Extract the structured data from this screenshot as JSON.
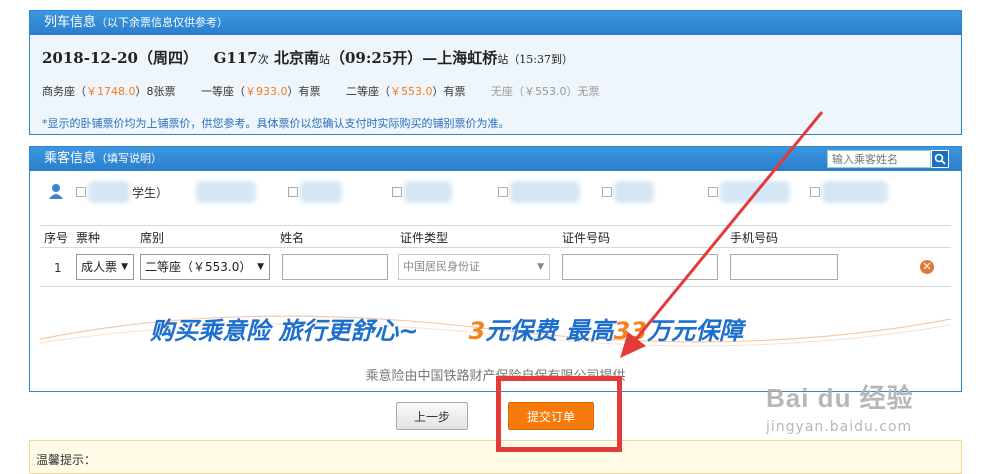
{
  "train_panel": {
    "title": "列车信息",
    "subtitle": "（以下余票信息仅供参考）",
    "date": "2018-12-20（周四）",
    "train_no": "G117",
    "train_suffix": "次",
    "from": "北京南",
    "from_suffix": "站",
    "depart": "（09:25开）",
    "dash": "—",
    "to": "上海虹桥",
    "to_suffix": "站",
    "arrive": "（15:37到）",
    "seats": [
      {
        "name": "商务座（",
        "price": "￥1748.0",
        "close": "）",
        "avail": "8张票"
      },
      {
        "name": "一等座（",
        "price": "￥933.0",
        "close": "）",
        "avail": "有票"
      },
      {
        "name": "二等座（",
        "price": "￥553.0",
        "close": "）",
        "avail": "有票"
      }
    ],
    "no_seat": "无座（￥553.0）无票",
    "note": "*显示的卧铺票价均为上铺票价，供您参考。具体票价以您确认支付时实际购买的铺别票价为准。"
  },
  "passenger_panel": {
    "title": "乘客信息",
    "subtitle": "（填写说明）",
    "search_placeholder": "输入乘客姓名",
    "first_contact_tail": "学生）",
    "columns": {
      "index": "序号",
      "ticket_type": "票种",
      "seat_class": "席别",
      "name": "姓名",
      "id_type": "证件类型",
      "id_no": "证件号码",
      "phone": "手机号码"
    },
    "row": {
      "index": "1",
      "ticket_type": "成人票",
      "seat_class": "二等座（￥553.0）",
      "id_type": "中国居民身份证"
    }
  },
  "banner": {
    "part1": "购买乘意险  旅行更舒心~",
    "num1": "3",
    "part2": "元保费  最高",
    "num2": "33",
    "part3": "万元保障",
    "sub": "乘意险由中国铁路财产保险自保有限公司提供"
  },
  "buttons": {
    "prev": "上一步",
    "submit": "提交订单"
  },
  "tips": {
    "title": "温馨提示："
  },
  "watermark": {
    "logo": "Bai du 经验",
    "url": "jingyan.baidu.com"
  },
  "colors": {
    "header_blue": "#2a7fcc",
    "price_orange": "#f47c20",
    "submit_orange": "#f77b0a",
    "annotation_red": "#e43a3a"
  }
}
